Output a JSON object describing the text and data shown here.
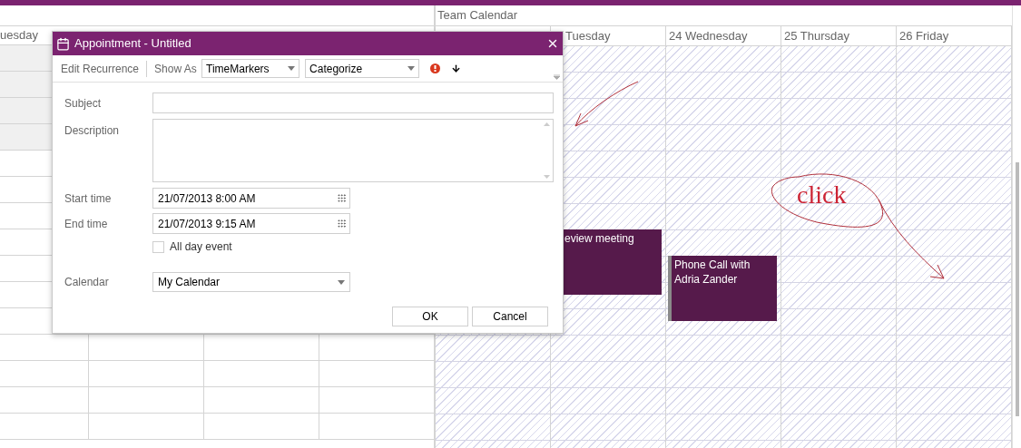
{
  "left_view": {
    "header": "uesday"
  },
  "team_calendar": {
    "title": "Team Calendar",
    "days": [
      {
        "label": "Tuesday",
        "events": [
          {
            "title": "eview meeting",
            "kind": "plain"
          }
        ]
      },
      {
        "label": "24 Wednesday",
        "events": [
          {
            "title": "Phone Call with Adria Zander",
            "kind": "marked"
          }
        ]
      },
      {
        "label": "25 Thursday"
      },
      {
        "label": "26 Friday"
      }
    ]
  },
  "annotation": {
    "text": "click"
  },
  "dialog": {
    "title": "Appointment - Untitled",
    "toolbar": {
      "edit_recurrence": "Edit Recurrence",
      "show_as_label": "Show As",
      "show_as_value": "TimeMarkers",
      "categorize": "Categorize"
    },
    "subject": {
      "label": "Subject"
    },
    "description": {
      "label": "Description"
    },
    "start_time": {
      "label": "Start time",
      "value": "21/07/2013 8:00 AM"
    },
    "end_time": {
      "label": "End time",
      "value": "21/07/2013 9:15 AM"
    },
    "all_day": {
      "label": "All day event",
      "checked": false
    },
    "calendar": {
      "label": "Calendar",
      "value": "My Calendar"
    },
    "buttons": [
      "OK",
      "Cancel"
    ]
  }
}
